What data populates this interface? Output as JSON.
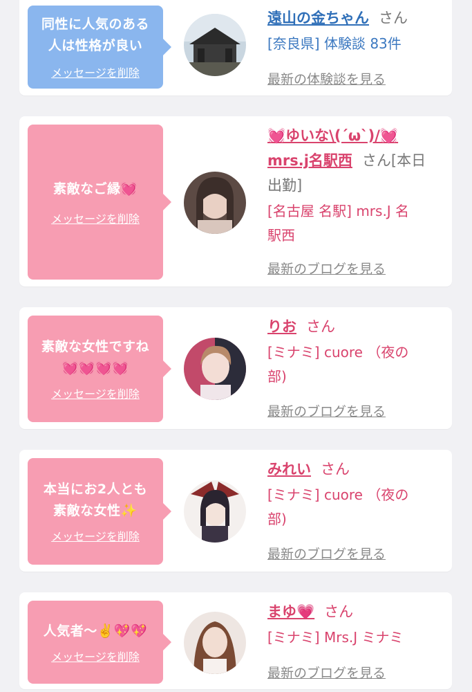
{
  "cards": [
    {
      "theme": "blue",
      "message_lines": [
        "同性に人気のある",
        "人は性格が良い"
      ],
      "delete_label": "メッセージを削除",
      "name": "遠山の金ちゃん",
      "honorific": "さん",
      "area_lines": [
        "[奈良県] 体験談 83件"
      ],
      "latest_link": "最新の体験談を見る"
    },
    {
      "theme": "pink",
      "message_lines": [
        "素敵なご縁💓"
      ],
      "delete_label": "メッセージを削除",
      "name_line1": "💓ゆいな\\(´ω`)/💓",
      "name_line2": "mrs.j名駅西",
      "honorific_line2": "さん[本日",
      "honorific_line3": "出勤]",
      "area_lines": [
        "[名古屋 名駅] mrs.J 名",
        "駅西"
      ],
      "latest_link": "最新のブログを見る"
    },
    {
      "theme": "pink",
      "message_lines": [
        "素敵な女性ですね",
        "💓💓💓💓"
      ],
      "delete_label": "メッセージを削除",
      "name": "りお",
      "honorific": "さん",
      "area_lines": [
        "[ミナミ] cuore （夜の",
        "部)"
      ],
      "latest_link": "最新のブログを見る"
    },
    {
      "theme": "pink",
      "message_lines": [
        "本当にお2人とも",
        "素敵な女性✨"
      ],
      "delete_label": "メッセージを削除",
      "name": "みれい",
      "honorific": "さん",
      "area_lines": [
        "[ミナミ] cuore （夜の",
        "部)"
      ],
      "latest_link": "最新のブログを見る"
    },
    {
      "theme": "pink",
      "message_lines": [
        "人気者〜✌️💖💖"
      ],
      "delete_label": "メッセージを削除",
      "name": "まゆ💗",
      "honorific": "さん",
      "area_lines": [
        "[ミナミ] Mrs.J ミナミ"
      ],
      "latest_link": "最新のブログを見る"
    }
  ],
  "colors": {
    "bubble_blue": "#8ab6ee",
    "bubble_pink": "#f79db2",
    "name_blue": "#2f6fb8",
    "name_pink": "#d9436d",
    "link_gray": "#8a8a8a"
  },
  "icons": {
    "avatar_1": "temple-photo",
    "avatar_2": "woman-portrait",
    "avatar_3": "woman-portrait",
    "avatar_4": "anime-character",
    "avatar_5": "woman-portrait"
  }
}
